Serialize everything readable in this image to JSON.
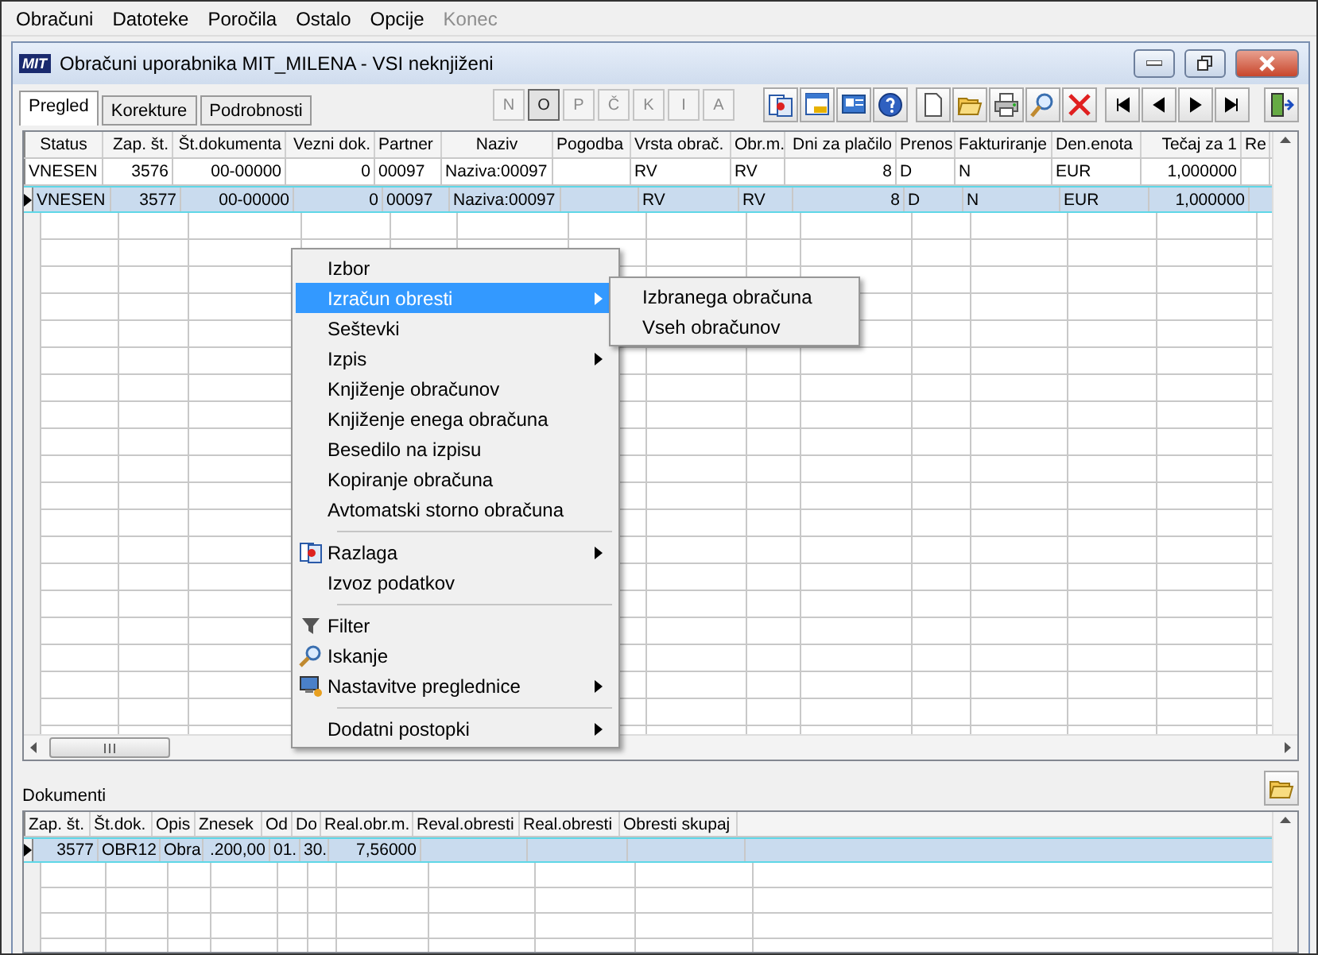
{
  "menubar": [
    {
      "label": "Obračuni",
      "disabled": false
    },
    {
      "label": "Datoteke",
      "disabled": false
    },
    {
      "label": "Poročila",
      "disabled": false
    },
    {
      "label": "Ostalo",
      "disabled": false
    },
    {
      "label": "Opcije",
      "disabled": false
    },
    {
      "label": "Konec",
      "disabled": true
    }
  ],
  "window": {
    "logo": "MIT",
    "title": "Obračuni uporabnika MIT_MILENA - VSI neknjiženi"
  },
  "tabs": [
    {
      "label": "Pregled",
      "selected": true
    },
    {
      "label": "Korekture",
      "selected": false
    },
    {
      "label": "Podrobnosti",
      "selected": false
    }
  ],
  "letter_buttons": [
    {
      "label": "N",
      "selected": false
    },
    {
      "label": "O",
      "selected": true
    },
    {
      "label": "P",
      "selected": false
    },
    {
      "label": "Č",
      "selected": false
    },
    {
      "label": "K",
      "selected": false
    },
    {
      "label": "I",
      "selected": false
    },
    {
      "label": "A",
      "selected": false
    }
  ],
  "table": {
    "columns": [
      {
        "label": "Status"
      },
      {
        "label": "Zap. št."
      },
      {
        "label": "Št.dokumenta"
      },
      {
        "label": "Vezni dok."
      },
      {
        "label": "Partner"
      },
      {
        "label": "Naziv"
      },
      {
        "label": "Pogodba"
      },
      {
        "label": "Vrsta obrač."
      },
      {
        "label": "Obr.m."
      },
      {
        "label": "Dni za plačilo"
      },
      {
        "label": "Prenos"
      },
      {
        "label": "Fakturiranje"
      },
      {
        "label": "Den.enota"
      },
      {
        "label": "Tečaj za 1"
      },
      {
        "label": "Re"
      }
    ],
    "rows": [
      {
        "selected": false,
        "cells": [
          "VNESEN",
          "3576",
          "00-00000",
          "0",
          "00097",
          "Naziva:00097",
          "",
          "RV",
          "RV",
          "8",
          "D",
          "N",
          "EUR",
          "1,000000",
          ""
        ]
      },
      {
        "selected": true,
        "cells": [
          "VNESEN",
          "3577",
          "00-00000",
          "0",
          "00097",
          "Naziva:00097",
          "",
          "RV",
          "RV",
          "8",
          "D",
          "N",
          "EUR",
          "1,000000",
          ""
        ]
      }
    ]
  },
  "context_menu": {
    "items": [
      {
        "kind": "item",
        "label": "Izbor",
        "submenu": false,
        "selected": false
      },
      {
        "kind": "item",
        "label": "Izračun obresti",
        "submenu": true,
        "selected": true,
        "children": [
          {
            "label": "Izbranega obračuna"
          },
          {
            "label": "Vseh obračunov"
          }
        ]
      },
      {
        "kind": "item",
        "label": "Seštevki",
        "submenu": false,
        "selected": false
      },
      {
        "kind": "item",
        "label": "Izpis",
        "submenu": true,
        "selected": false
      },
      {
        "kind": "item",
        "label": "Knjiženje obračunov",
        "submenu": false,
        "selected": false
      },
      {
        "kind": "item",
        "label": "Knjiženje enega obračuna",
        "submenu": false,
        "selected": false
      },
      {
        "kind": "item",
        "label": "Besedilo na izpisu",
        "submenu": false,
        "selected": false
      },
      {
        "kind": "item",
        "label": "Kopiranje obračuna",
        "submenu": false,
        "selected": false
      },
      {
        "kind": "item",
        "label": "Avtomatski storno obračuna",
        "submenu": false,
        "selected": false
      },
      {
        "kind": "separator"
      },
      {
        "kind": "icon",
        "label": "Razlaga",
        "submenu": true,
        "selected": false
      },
      {
        "kind": "item",
        "label": "Izvoz podatkov",
        "submenu": false,
        "selected": false
      },
      {
        "kind": "separator"
      },
      {
        "kind": "icon",
        "label": "Filter",
        "submenu": false,
        "selected": false
      },
      {
        "kind": "icon",
        "label": "Iskanje",
        "submenu": false,
        "selected": false
      },
      {
        "kind": "icon",
        "label": "Nastavitve preglednice",
        "submenu": true,
        "selected": false
      },
      {
        "kind": "separator"
      },
      {
        "kind": "item",
        "label": "Dodatni postopki",
        "submenu": true,
        "selected": false
      }
    ]
  },
  "documents": {
    "title": "Dokumenti",
    "columns": [
      {
        "label": "Zap. št."
      },
      {
        "label": "Št.dok."
      },
      {
        "label": "Opis"
      },
      {
        "label": "Znesek"
      },
      {
        "label": "Od"
      },
      {
        "label": "Do"
      },
      {
        "label": "Real.obr.m."
      },
      {
        "label": "Reval.obresti"
      },
      {
        "label": "Real.obresti"
      },
      {
        "label": "Obresti skupaj"
      }
    ],
    "rows": [
      {
        "selected": true,
        "cells": [
          "3577",
          "OBR12",
          "Obra",
          ".200,00",
          "01.",
          "30.",
          "7,56000",
          "",
          "",
          ""
        ]
      }
    ]
  }
}
